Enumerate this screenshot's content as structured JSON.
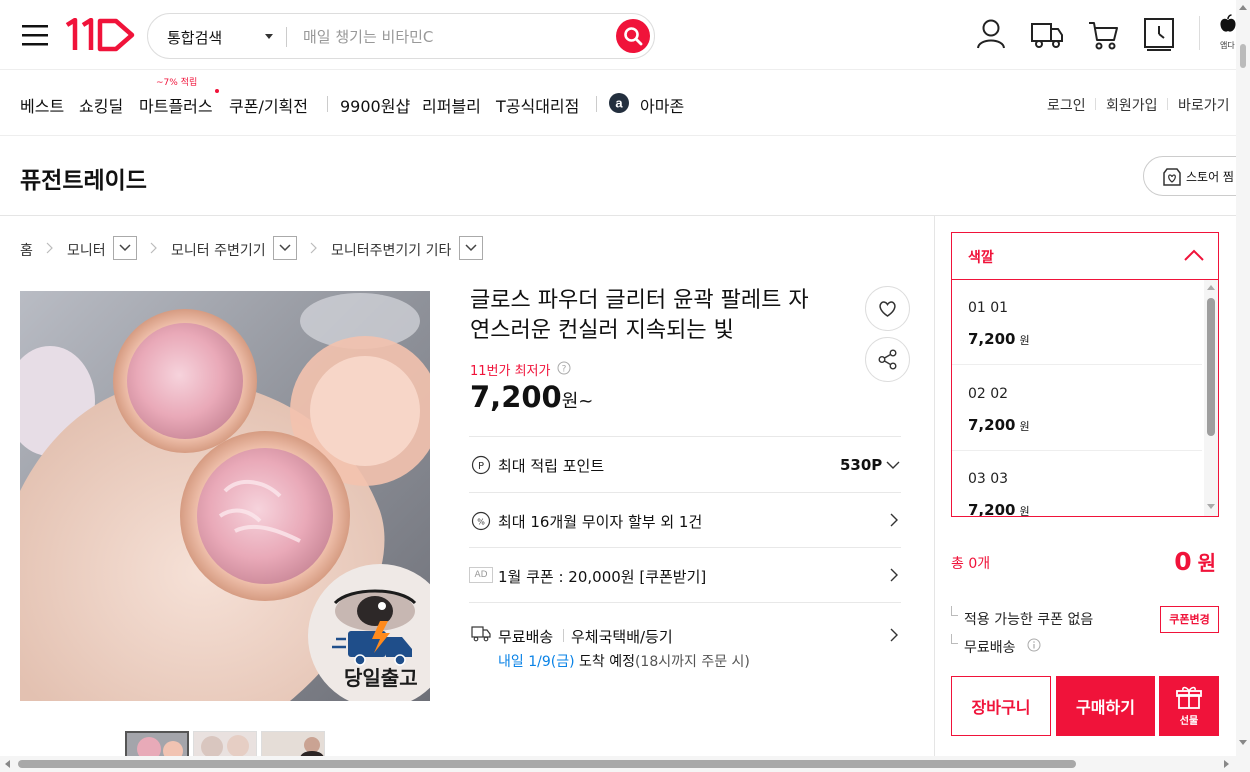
{
  "header": {
    "logo_text": "11",
    "search_category": "통합검색",
    "search_placeholder": "매일 챙기는 비타민C",
    "app_label": "앱다"
  },
  "nav": {
    "items": [
      "베스트",
      "쇼킹딜",
      "마트플러스",
      "쿠폰/기획전",
      "9900원샵",
      "리퍼블리",
      "T공식대리점",
      "아마존"
    ],
    "mart_badge": "~7% 적립",
    "right_items": [
      "로그인",
      "회원가입",
      "바로가기"
    ]
  },
  "store": {
    "name": "퓨전트레이드",
    "zzim_label": "스토어 찜"
  },
  "breadcrumb": [
    "홈",
    "모니터",
    "모니터 주변기기",
    "모니터주변기기 기타"
  ],
  "product": {
    "title_line1": "글로스 파우더 글리터 윤곽 팔레트 자",
    "title_line2": "연스러운 컨실러 지속되는 빛",
    "lowest_label": "11번가 최저가",
    "price": "7,200",
    "price_unit": "원~",
    "image_badge": "당일출고",
    "points_label": "최대 적립 포인트",
    "points_value": "530P",
    "installment": "최대 16개월 무이자 할부 외 1건",
    "ad_tag": "AD",
    "coupon": "1월 쿠폰 : 20,000원 [쿠폰받기]",
    "shipping_free": "무료배송",
    "shipping_method": "우체국택배/등기",
    "arrival_date": "내일 1/9(금)",
    "arrival_suffix": " 도착 예정",
    "arrival_note": "(18시까지 주문 시)"
  },
  "side": {
    "option_title": "색깔",
    "options": [
      {
        "name": "01 01",
        "price": "7,200",
        "unit": "원"
      },
      {
        "name": "02 02",
        "price": "7,200",
        "unit": "원"
      },
      {
        "name": "03 03",
        "price": "7,200",
        "unit": "원"
      }
    ],
    "total_label": "총 0개",
    "total_value": "0",
    "total_unit": "원",
    "coupon_none": "적용 가능한 쿠폰 없음",
    "coupon_change": "쿠폰변경",
    "free_shipping": "무료배송",
    "cart_button": "장바구니",
    "buy_button": "구매하기",
    "gift_button": "선물"
  },
  "colors": {
    "accent": "#f0133a",
    "link_blue": "#0b83e6"
  }
}
